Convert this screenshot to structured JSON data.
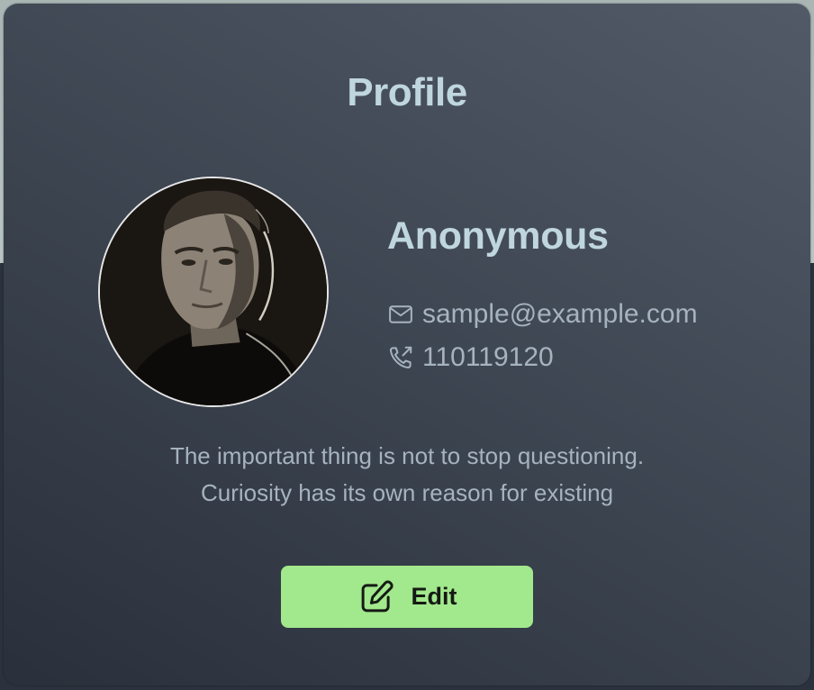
{
  "card": {
    "title": "Profile"
  },
  "profile": {
    "name": "Anonymous",
    "email": "sample@example.com",
    "phone": "110119120",
    "quote_line1": "The important thing is not to stop questioning.",
    "quote_line2": "Curiosity has its own reason for existing",
    "avatar_icon": "portrait-photo"
  },
  "icons": {
    "email": "mail-icon",
    "phone": "phone-outgoing-icon",
    "edit": "pencil-square-icon"
  },
  "actions": {
    "edit_label": "Edit"
  },
  "colors": {
    "accent": "#a2e88c",
    "heading": "#bfd6dd",
    "text_muted": "#a6b3bf"
  }
}
